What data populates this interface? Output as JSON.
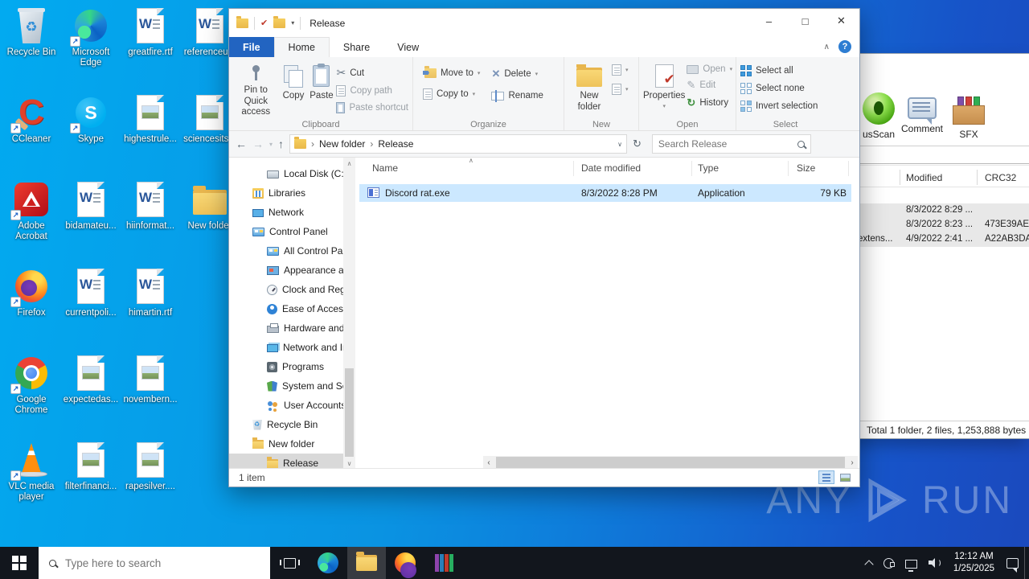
{
  "glyphs": {
    "back": "←",
    "forward": "→",
    "up": "↑",
    "refresh": "↻",
    "dropdown": "▾",
    "crumb_sep": "›",
    "ribbon_collapse": "∧",
    "help": "?",
    "minimize": "–",
    "maximize": "□",
    "close": "✕",
    "sort": "∧",
    "left": "‹",
    "right": "›",
    "nav_up": "∧",
    "nav_down": "∨",
    "cut": "✂",
    "delete": "✕",
    "check": "✔",
    "edit": "✎",
    "history": "↻",
    "recycle": "♻",
    "shortcut": "↗",
    "word_w": "W",
    "skype_s": "S",
    "ccleaner_c": "C"
  },
  "desktop": {
    "watermark": {
      "any": "ANY",
      "run": "RUN"
    },
    "icons": [
      {
        "label": "Recycle Bin",
        "kind": "recycle-bin",
        "shortcut": false,
        "row": 1,
        "col": 1
      },
      {
        "label": "Microsoft Edge",
        "kind": "edge",
        "shortcut": true,
        "row": 1,
        "col": 2
      },
      {
        "label": "greatfire.rtf",
        "kind": "word",
        "shortcut": false,
        "row": 1,
        "col": 3
      },
      {
        "label": "referenceu...",
        "kind": "word",
        "shortcut": false,
        "row": 1,
        "col": 4
      },
      {
        "label": "CCleaner",
        "kind": "ccleaner",
        "shortcut": true,
        "row": 2,
        "col": 1
      },
      {
        "label": "Skype",
        "kind": "skype",
        "shortcut": true,
        "row": 2,
        "col": 2
      },
      {
        "label": "highestrule...",
        "kind": "image",
        "shortcut": false,
        "row": 2,
        "col": 3
      },
      {
        "label": "sciencesits...",
        "kind": "image",
        "shortcut": false,
        "row": 2,
        "col": 4
      },
      {
        "label": "Adobe Acrobat",
        "kind": "acrobat",
        "shortcut": true,
        "row": 3,
        "col": 1
      },
      {
        "label": "bidamateu...",
        "kind": "word",
        "shortcut": false,
        "row": 3,
        "col": 2
      },
      {
        "label": "hiinformat...",
        "kind": "word",
        "shortcut": false,
        "row": 3,
        "col": 3
      },
      {
        "label": "New folder",
        "kind": "folder",
        "shortcut": false,
        "row": 3,
        "col": 4
      },
      {
        "label": "Firefox",
        "kind": "firefox",
        "shortcut": true,
        "row": 4,
        "col": 1
      },
      {
        "label": "currentpoli...",
        "kind": "word",
        "shortcut": false,
        "row": 4,
        "col": 2
      },
      {
        "label": "himartin.rtf",
        "kind": "word",
        "shortcut": false,
        "row": 4,
        "col": 3
      },
      {
        "label": "Google Chrome",
        "kind": "chrome",
        "shortcut": true,
        "row": 5,
        "col": 1
      },
      {
        "label": "expectedas...",
        "kind": "image",
        "shortcut": false,
        "row": 5,
        "col": 2
      },
      {
        "label": "novembern...",
        "kind": "image",
        "shortcut": false,
        "row": 5,
        "col": 3
      },
      {
        "label": "VLC media player",
        "kind": "vlc",
        "shortcut": true,
        "row": 6,
        "col": 1
      },
      {
        "label": "filterfinanci...",
        "kind": "image",
        "shortcut": false,
        "row": 6,
        "col": 2
      },
      {
        "label": "rapesilver....",
        "kind": "image",
        "shortcut": false,
        "row": 6,
        "col": 3
      }
    ]
  },
  "explorer": {
    "title": "Release",
    "tabs": {
      "file": "File",
      "home": "Home",
      "share": "Share",
      "view": "View"
    },
    "ribbon": {
      "pin": "Pin to Quick access",
      "copy": "Copy",
      "paste": "Paste",
      "cut": "Cut",
      "copy_path": "Copy path",
      "paste_shortcut": "Paste shortcut",
      "group_clipboard": "Clipboard",
      "move_to": "Move to",
      "copy_to": "Copy to",
      "delete": "Delete",
      "rename": "Rename",
      "group_organize": "Organize",
      "new_folder": "New folder",
      "group_new": "New",
      "properties": "Properties",
      "open": "Open",
      "edit": "Edit",
      "history": "History",
      "group_open": "Open",
      "select_all": "Select all",
      "select_none": "Select none",
      "invert_selection": "Invert selection",
      "group_select": "Select"
    },
    "address": {
      "crumbs": [
        "New folder",
        "Release"
      ],
      "search": "Search Release"
    },
    "nav": [
      {
        "label": "Local Disk (C:)",
        "level": 2,
        "kind": "drive",
        "selected": false
      },
      {
        "label": "Libraries",
        "level": 1,
        "kind": "libraries",
        "selected": false
      },
      {
        "label": "Network",
        "level": 1,
        "kind": "network",
        "selected": false
      },
      {
        "label": "Control Panel",
        "level": 1,
        "kind": "cpl",
        "selected": false
      },
      {
        "label": "All Control Pan",
        "level": 2,
        "kind": "cpl",
        "selected": false
      },
      {
        "label": "Appearance an",
        "level": 2,
        "kind": "appearance",
        "selected": false
      },
      {
        "label": "Clock and Regi",
        "level": 2,
        "kind": "clock",
        "selected": false
      },
      {
        "label": "Ease of Access",
        "level": 2,
        "kind": "ease",
        "selected": false
      },
      {
        "label": "Hardware and",
        "level": 2,
        "kind": "hardware",
        "selected": false
      },
      {
        "label": "Network and In",
        "level": 2,
        "kind": "netinet",
        "selected": false
      },
      {
        "label": "Programs",
        "level": 2,
        "kind": "programs",
        "selected": false
      },
      {
        "label": "System and Se",
        "level": 2,
        "kind": "system",
        "selected": false
      },
      {
        "label": "User Accounts",
        "level": 2,
        "kind": "users",
        "selected": false
      },
      {
        "label": "Recycle Bin",
        "level": 1,
        "kind": "recycle",
        "selected": false
      },
      {
        "label": "New folder",
        "level": 1,
        "kind": "folder",
        "selected": false
      },
      {
        "label": "Release",
        "level": 2,
        "kind": "folder",
        "selected": true
      }
    ],
    "list": {
      "headers": [
        "Name",
        "Date modified",
        "Type",
        "Size"
      ],
      "rows": [
        {
          "name": "Discord rat.exe",
          "modified": "8/3/2022 8:28 PM",
          "type": "Application",
          "size": "79 KB"
        }
      ]
    },
    "status": "1 item"
  },
  "winrar": {
    "tools": [
      "usScan",
      "Comment",
      "SFX"
    ],
    "headers": {
      "modified": "Modified",
      "crc": "CRC32"
    },
    "rows": [
      {
        "name": "",
        "modified": "8/3/2022 8:29 ...",
        "crc": ""
      },
      {
        "name": "",
        "modified": "8/3/2022 8:23 ...",
        "crc": "473E39AE"
      },
      {
        "name": "extens...",
        "modified": "4/9/2022 2:41 ...",
        "crc": "A22AB3DA"
      }
    ],
    "status": "Total 1 folder, 2 files, 1,253,888 bytes"
  },
  "taskbar": {
    "search_placeholder": "Type here to search",
    "apps": [
      {
        "id": "edge",
        "active": false
      },
      {
        "id": "explorer",
        "active": true
      },
      {
        "id": "firefox",
        "active": false
      },
      {
        "id": "winrar",
        "active": false
      }
    ],
    "clock": {
      "time": "12:12 AM",
      "date": "1/25/2025"
    }
  }
}
